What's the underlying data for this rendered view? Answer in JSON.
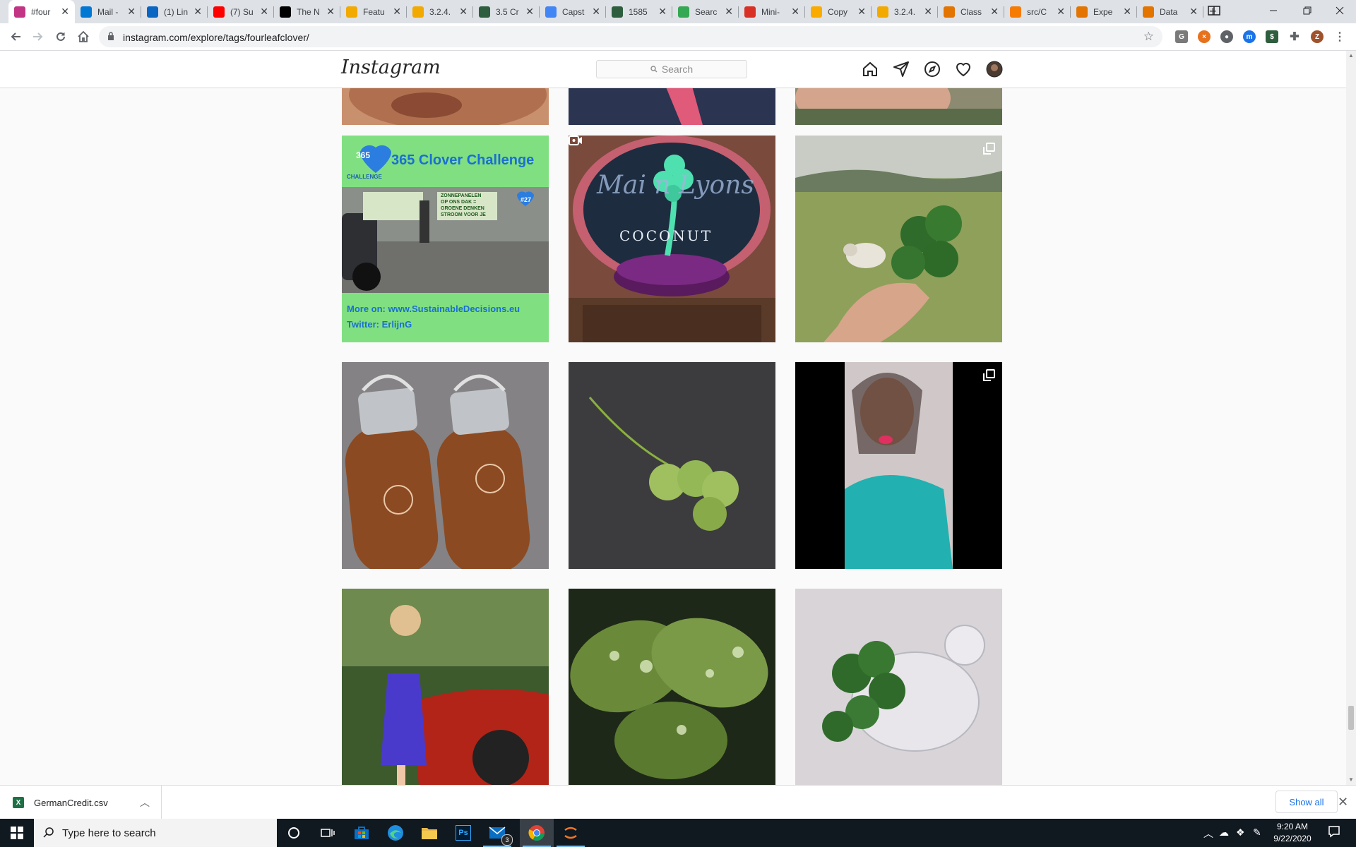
{
  "browser": {
    "tabs": [
      {
        "title": "#four",
        "color": "#c13584",
        "active": true
      },
      {
        "title": "Mail -",
        "color": "#0078d4"
      },
      {
        "title": "(1) Lin",
        "color": "#0a66c2"
      },
      {
        "title": "(7) Su",
        "color": "#ff0000"
      },
      {
        "title": "The N",
        "color": "#000000"
      },
      {
        "title": "Featu",
        "color": "#f2a900"
      },
      {
        "title": "3.2.4.",
        "color": "#f2a900"
      },
      {
        "title": "3.5 Cr",
        "color": "#2e5e3e"
      },
      {
        "title": "Capst",
        "color": "#4285f4"
      },
      {
        "title": "1585",
        "color": "#2e5e3e"
      },
      {
        "title": "Searc",
        "color": "#34a853"
      },
      {
        "title": "Mini-",
        "color": "#d93025"
      },
      {
        "title": "Copy",
        "color": "#f9ab00"
      },
      {
        "title": "3.2.4.",
        "color": "#f2a900"
      },
      {
        "title": "Class",
        "color": "#e37400"
      },
      {
        "title": "src/C",
        "color": "#f57c00"
      },
      {
        "title": "Expe",
        "color": "#e37400"
      },
      {
        "title": "Data",
        "color": "#e37400"
      }
    ],
    "url": "instagram.com/explore/tags/fourleafclover/"
  },
  "instagram": {
    "logo": "Instagram",
    "search_placeholder": "Search"
  },
  "posts": [
    {
      "alt": "365 Clover Challenge banner",
      "headline": "365 Clover Challenge",
      "badge": "365",
      "badge_sub": "CHALLENGE",
      "day": "#27",
      "footer1": "More on: www.SustainableDecisions.eu",
      "footer2": "Twitter: ErlijnG",
      "sign1": "ZONNEPANELEN",
      "sign2": "OP ONS DAK =",
      "sign3": "GROENE DENKEN",
      "sign4": "STROOM VOOR JE"
    },
    {
      "alt": "Mermaid Lyons Coconut glass with clover",
      "script": "Mai n Lyons",
      "text": "COCONUT",
      "type": "igtv"
    },
    {
      "alt": "Hand holding four leaf clover with sheep",
      "type": "multi"
    },
    {
      "alt": "Two wooden water bottles with clover engraving"
    },
    {
      "alt": "Pressed clover on dark background"
    },
    {
      "alt": "Woman in blue top selfie",
      "type": "multi"
    },
    {
      "alt": "Woman in floral dress by red car"
    },
    {
      "alt": "Clover leaves with water droplets"
    },
    {
      "alt": "Clover in glass bird vase"
    }
  ],
  "downloads": {
    "file": "GermanCredit.csv",
    "show_all": "Show all"
  },
  "taskbar": {
    "search_placeholder": "Type here to search",
    "time": "9:20 AM",
    "date": "9/22/2020",
    "mail_badge": "3"
  }
}
